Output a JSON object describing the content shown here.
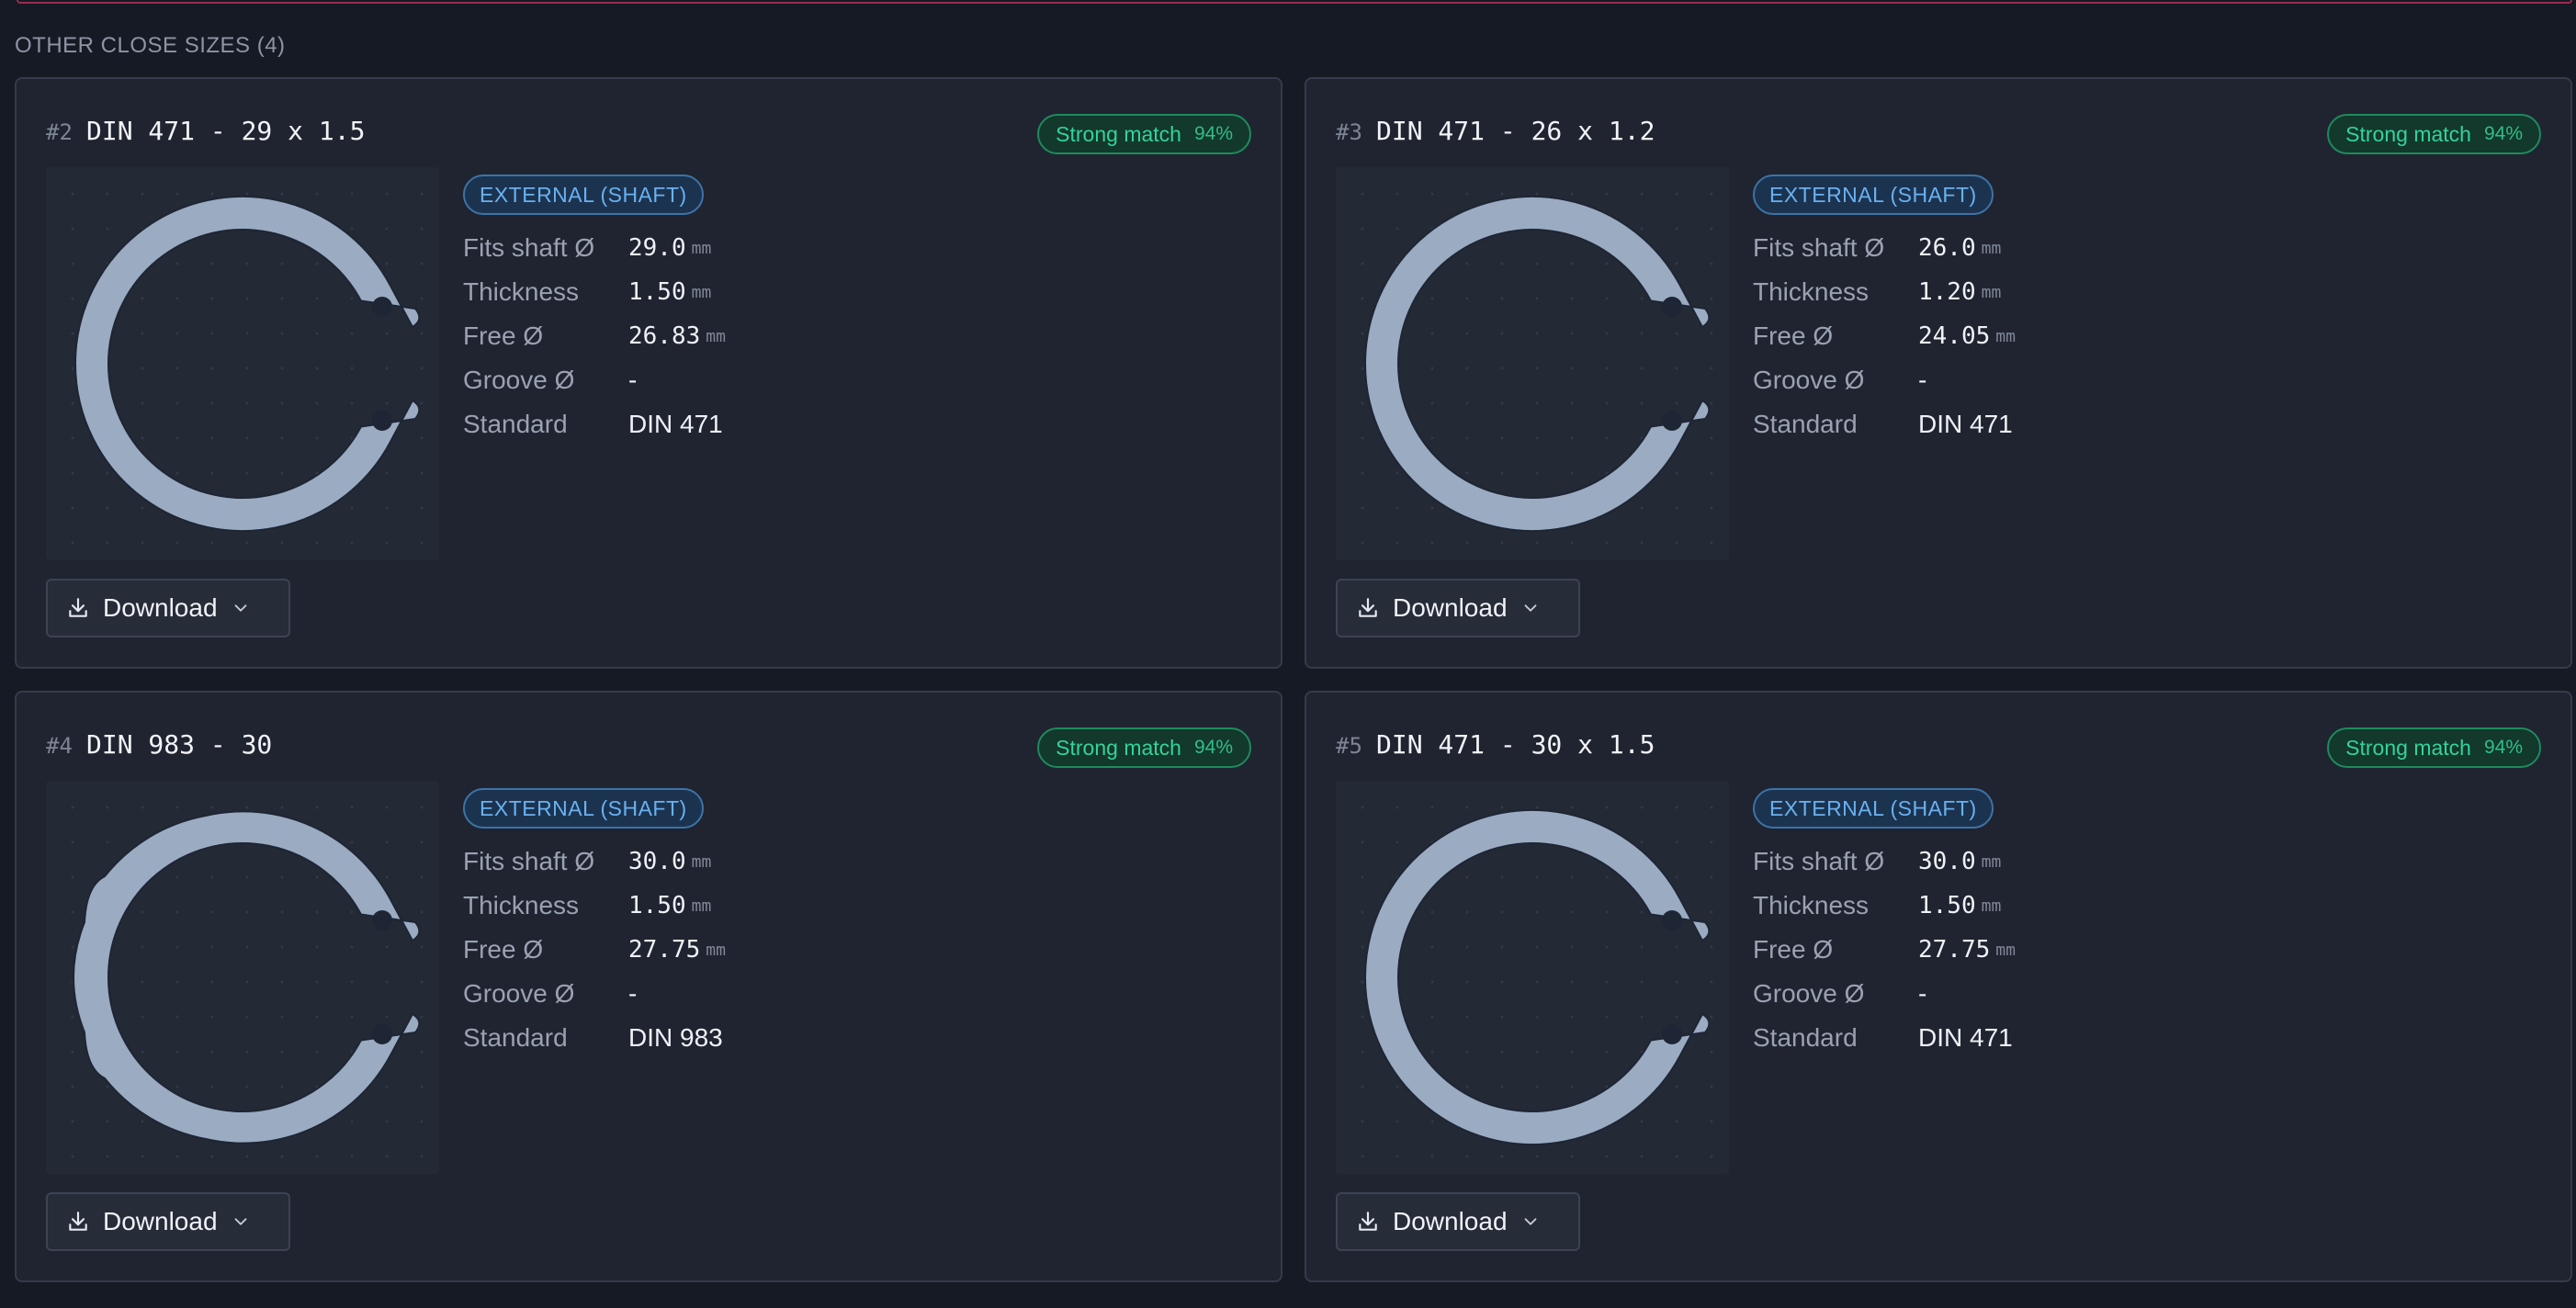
{
  "section": {
    "title": "OTHER CLOSE SIZES (4)"
  },
  "cards": [
    {
      "rank": "#2",
      "name": "DIN 471 - 29 x 1.5",
      "match_label": "Strong match",
      "match_pct": "94%",
      "type": "EXTERNAL (SHAFT)",
      "specs": [
        {
          "label": "Fits shaft Ø",
          "value": "29.0",
          "unit": "mm"
        },
        {
          "label": "Thickness",
          "value": "1.50",
          "unit": "mm"
        },
        {
          "label": "Free Ø",
          "value": "26.83",
          "unit": "mm"
        },
        {
          "label": "Groove Ø",
          "value": "-",
          "unit": ""
        },
        {
          "label": "Standard",
          "value": "DIN 471",
          "unit": ""
        }
      ],
      "download_label": "Download",
      "ring_style": "din471"
    },
    {
      "rank": "#3",
      "name": "DIN 471 - 26 x 1.2",
      "match_label": "Strong match",
      "match_pct": "94%",
      "type": "EXTERNAL (SHAFT)",
      "specs": [
        {
          "label": "Fits shaft Ø",
          "value": "26.0",
          "unit": "mm"
        },
        {
          "label": "Thickness",
          "value": "1.20",
          "unit": "mm"
        },
        {
          "label": "Free Ø",
          "value": "24.05",
          "unit": "mm"
        },
        {
          "label": "Groove Ø",
          "value": "-",
          "unit": ""
        },
        {
          "label": "Standard",
          "value": "DIN 471",
          "unit": ""
        }
      ],
      "download_label": "Download",
      "ring_style": "din471"
    },
    {
      "rank": "#4",
      "name": "DIN 983 - 30",
      "match_label": "Strong match",
      "match_pct": "94%",
      "type": "EXTERNAL (SHAFT)",
      "specs": [
        {
          "label": "Fits shaft Ø",
          "value": "30.0",
          "unit": "mm"
        },
        {
          "label": "Thickness",
          "value": "1.50",
          "unit": "mm"
        },
        {
          "label": "Free Ø",
          "value": "27.75",
          "unit": "mm"
        },
        {
          "label": "Groove Ø",
          "value": "-",
          "unit": ""
        },
        {
          "label": "Standard",
          "value": "DIN 983",
          "unit": ""
        }
      ],
      "download_label": "Download",
      "ring_style": "din983"
    },
    {
      "rank": "#5",
      "name": "DIN 471 - 30 x 1.5",
      "match_label": "Strong match",
      "match_pct": "94%",
      "type": "EXTERNAL (SHAFT)",
      "specs": [
        {
          "label": "Fits shaft Ø",
          "value": "30.0",
          "unit": "mm"
        },
        {
          "label": "Thickness",
          "value": "1.50",
          "unit": "mm"
        },
        {
          "label": "Free Ø",
          "value": "27.75",
          "unit": "mm"
        },
        {
          "label": "Groove Ø",
          "value": "-",
          "unit": ""
        },
        {
          "label": "Standard",
          "value": "DIN 471",
          "unit": ""
        }
      ],
      "download_label": "Download",
      "ring_style": "din471"
    }
  ],
  "colors": {
    "ring": "#9aabc2",
    "ring_edge": "#1e2534",
    "match_green": "#34d399",
    "badge_blue": "#69b1f0"
  },
  "icons": {
    "download": "download-icon",
    "dropdown": "chevron-down-icon"
  }
}
